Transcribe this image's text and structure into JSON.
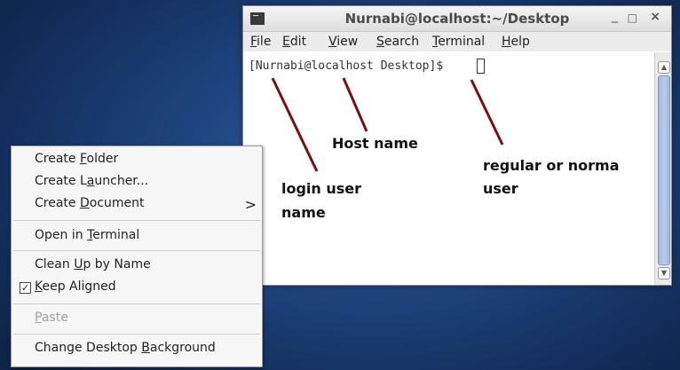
{
  "terminal": {
    "title": "Nurnabi@localhost:~/Desktop",
    "controls": {
      "minimize": "_",
      "maximize": "□",
      "close": "×"
    },
    "menu": [
      {
        "pre": "",
        "u": "F",
        "post": "ile"
      },
      {
        "pre": "",
        "u": "E",
        "post": "dit"
      },
      {
        "pre": "",
        "u": "V",
        "post": "iew"
      },
      {
        "pre": "",
        "u": "S",
        "post": "earch"
      },
      {
        "pre": "",
        "u": "T",
        "post": "erminal"
      },
      {
        "pre": "",
        "u": "H",
        "post": "elp"
      }
    ],
    "prompt": "[Nurnabi@localhost Desktop]$"
  },
  "annotations": {
    "host_name": "Host name",
    "login_user_line1": "login user",
    "login_user_line2": "name",
    "regular_line1": "regular or norma",
    "regular_line2": "user"
  },
  "context_menu": {
    "items": [
      {
        "pre": "Create ",
        "u": "F",
        "post": "older"
      },
      {
        "pre": "Create L",
        "u": "a",
        "post": "uncher..."
      },
      {
        "pre": "Create ",
        "u": "D",
        "post": "ocument"
      },
      {
        "pre": "Open in ",
        "u": "T",
        "post": "erminal"
      },
      {
        "pre": "Clean ",
        "u": "U",
        "post": "p by Name"
      },
      {
        "pre": "",
        "u": "K",
        "post": "eep Aligned"
      },
      {
        "pre": "",
        "u": "P",
        "post": "aste"
      },
      {
        "pre": "Change Desktop ",
        "u": "B",
        "post": "ackground"
      }
    ],
    "submenu_arrow": ">",
    "check_mark": "✓"
  },
  "colors": {
    "desktop_bg": "#1f4580",
    "scroll_thumb": "#9fb9dc",
    "annotation_line": "#7a1010"
  }
}
